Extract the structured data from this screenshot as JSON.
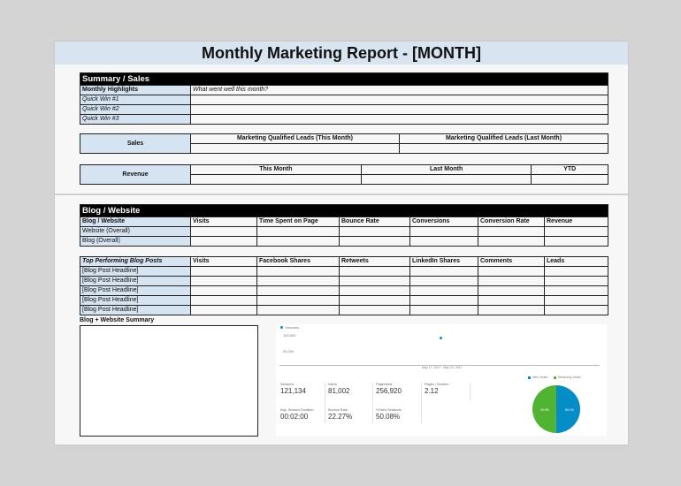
{
  "title": "Monthly Marketing Report - [MONTH]",
  "summary_sales": {
    "header": "Summary / Sales",
    "highlights_label": "Monthly Highlights",
    "highlights_value": "What went well this month?",
    "quick_wins": [
      "Quick Win #1",
      "Quick Win #2",
      "Quick Win #3"
    ],
    "sales_label": "Sales",
    "sales_cols": [
      "Marketing Qualified Leads (This Month)",
      "Marketing Qualified Leads (Last Month)"
    ],
    "revenue_label": "Revenue",
    "revenue_cols": [
      "This Month",
      "Last Month",
      "YTD"
    ]
  },
  "blog": {
    "header": "Blog / Website",
    "table1_cols": [
      "Blog / Website",
      "Visits",
      "Time Spent on Page",
      "Bounce Rate",
      "Conversions",
      "Conversion Rate",
      "Revenue"
    ],
    "table1_rows": [
      "Website (Overall)",
      "Blog (Overall)"
    ],
    "table2_cols": [
      "Top Performing Blog Posts",
      "Visits",
      "Facebook Shares",
      "Retweets",
      "LinkedIn Shares",
      "Comments",
      "Leads"
    ],
    "table2_rows": [
      "[Blog Post Headline]",
      "[Blog Post Headline]",
      "[Blog Post Headline]",
      "[Blog Post Headline]",
      "[Blog Post Headline]"
    ],
    "summary_label": "Blog + Website Summary"
  },
  "dashboard": {
    "legend": "Sessions",
    "y_top": "100,000",
    "y_mid": "50,000",
    "x_range": "May 17, 2017 - May 23, 2017",
    "metrics": [
      {
        "label": "Sessions",
        "value": "121,134"
      },
      {
        "label": "Users",
        "value": "81,002"
      },
      {
        "label": "Pageviews",
        "value": "256,920"
      },
      {
        "label": "Pages / Session",
        "value": "2.12"
      },
      {
        "label": "Avg. Session Duration",
        "value": "00:02:00"
      },
      {
        "label": "Bounce Rate",
        "value": "22.27%"
      },
      {
        "label": "% New Sessions",
        "value": "50.08%"
      }
    ],
    "pie_legend": [
      "New Visitor",
      "Returning Visitor"
    ],
    "pie_values": [
      49.9,
      50.1
    ],
    "pie_labels": [
      "49.9%",
      "50.1%"
    ],
    "colors": {
      "new": "#50b432",
      "returning": "#058dc7"
    }
  }
}
